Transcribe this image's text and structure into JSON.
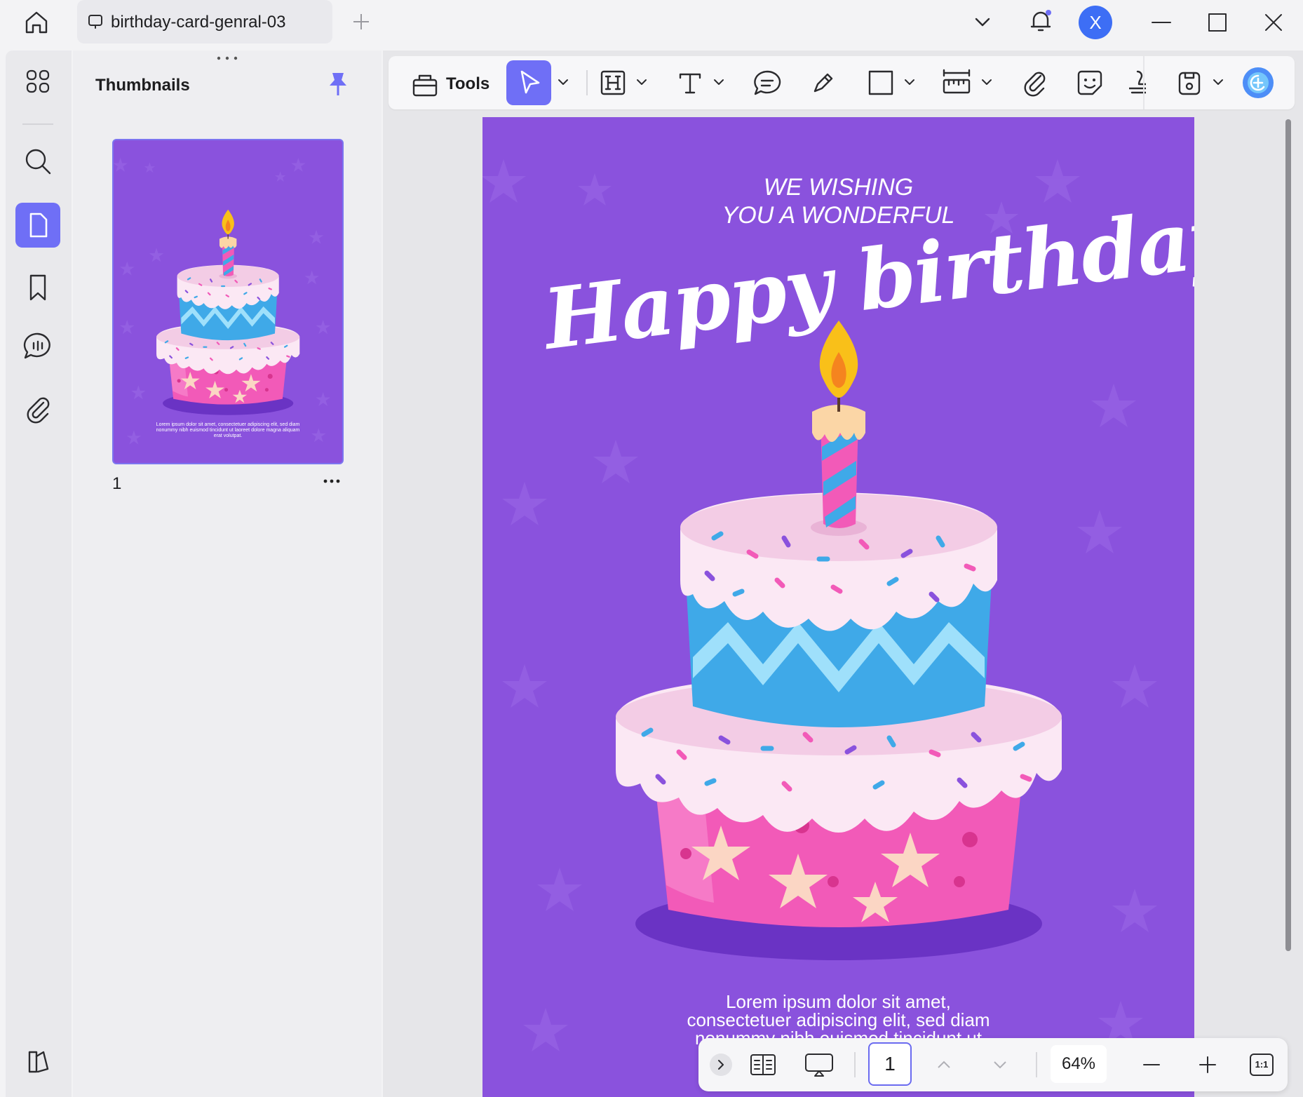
{
  "window": {
    "tab_title": "birthday-card-genral-03",
    "avatar_letter": "X"
  },
  "sidebar": {
    "items": [
      {
        "name": "grid"
      },
      {
        "name": "search"
      },
      {
        "name": "pages",
        "active": true
      },
      {
        "name": "bookmark"
      },
      {
        "name": "comments"
      },
      {
        "name": "attachments"
      }
    ]
  },
  "thumbnails": {
    "title": "Thumbnails",
    "pages": [
      {
        "number": "1"
      }
    ]
  },
  "toolbar": {
    "tools_label": "Tools"
  },
  "document": {
    "heading_line1": "WE WISHING",
    "heading_line2": "YOU A WONDERFUL",
    "script_title": "Happy birthday",
    "body_line1": "Lorem ipsum dolor sit amet,",
    "body_line2": "consectetuer adipiscing elit, sed diam",
    "body_line3": "nonummy nibh euismod tincidunt ut",
    "thumb_body": "Lorem ipsum dolor sit amet, consectetuer adipiscing elit, sed diam nonummy nibh euismod tincidunt ut laoreet dolore magna aliquam erat volutpat."
  },
  "navigation": {
    "current_page": "1",
    "zoom": "64%",
    "fit_label": "1:1"
  },
  "colors": {
    "accent": "#6f6ff6",
    "card_purple": "#8a52dd",
    "cake_blue": "#3fa9e8",
    "cake_pink": "#f25ab8",
    "cake_icing": "#fbe8f4"
  }
}
